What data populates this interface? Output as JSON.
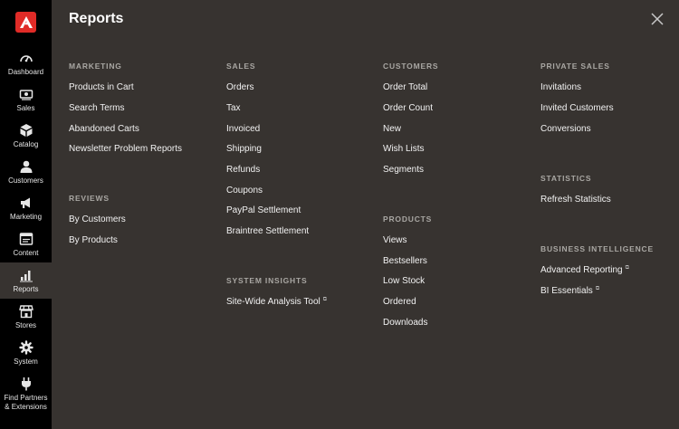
{
  "sidebar": {
    "logo_letter": "A",
    "items": [
      {
        "label": "Dashboard",
        "icon": "dashboard-icon"
      },
      {
        "label": "Sales",
        "icon": "sales-icon"
      },
      {
        "label": "Catalog",
        "icon": "catalog-icon"
      },
      {
        "label": "Customers",
        "icon": "customers-icon"
      },
      {
        "label": "Marketing",
        "icon": "marketing-icon"
      },
      {
        "label": "Content",
        "icon": "content-icon"
      },
      {
        "label": "Reports",
        "icon": "reports-icon",
        "active": true
      },
      {
        "label": "Stores",
        "icon": "stores-icon"
      },
      {
        "label": "System",
        "icon": "system-icon"
      },
      {
        "label": "Find Partners",
        "label2": "& Extensions",
        "icon": "extensions-icon"
      }
    ]
  },
  "panel": {
    "title": "Reports",
    "close_icon": "close-icon"
  },
  "sections": {
    "marketing": {
      "title": "Marketing",
      "links": [
        "Products in Cart",
        "Search Terms",
        "Abandoned Carts",
        "Newsletter Problem Reports"
      ]
    },
    "reviews": {
      "title": "Reviews",
      "links": [
        "By Customers",
        "By Products"
      ]
    },
    "sales": {
      "title": "Sales",
      "links": [
        "Orders",
        "Tax",
        "Invoiced",
        "Shipping",
        "Refunds",
        "Coupons",
        "PayPal Settlement",
        "Braintree Settlement"
      ]
    },
    "system_insights": {
      "title": "System Insights",
      "links": [
        "Site-Wide Analysis Tool"
      ]
    },
    "customers": {
      "title": "Customers",
      "links": [
        "Order Total",
        "Order Count",
        "New",
        "Wish Lists",
        "Segments"
      ]
    },
    "products": {
      "title": "Products",
      "links": [
        "Views",
        "Bestsellers",
        "Low Stock",
        "Ordered",
        "Downloads"
      ]
    },
    "private_sales": {
      "title": "Private Sales",
      "links": [
        "Invitations",
        "Invited Customers",
        "Conversions"
      ]
    },
    "statistics": {
      "title": "Statistics",
      "links": [
        "Refresh Statistics"
      ]
    },
    "business_intelligence": {
      "title": "Business Intelligence",
      "links": [
        "Advanced Reporting",
        "BI Essentials"
      ]
    }
  },
  "colors": {
    "sidebar_bg": "#000000",
    "panel_bg": "#373330",
    "logo_red": "#e02b27",
    "section_title": "#a9a7a3"
  }
}
